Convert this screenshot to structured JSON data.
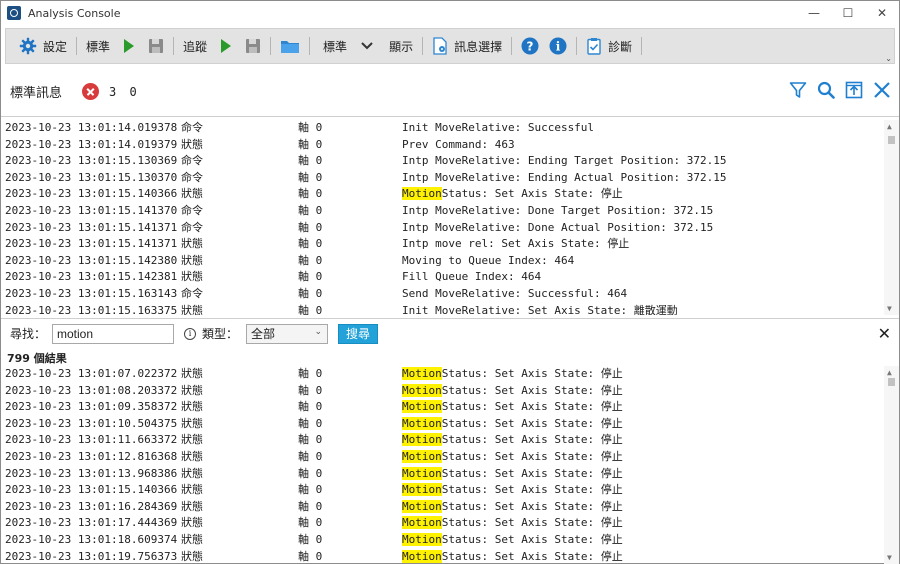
{
  "window": {
    "title": "Analysis Console",
    "minimize": "—",
    "maximize": "☐",
    "close": "✕"
  },
  "toolbar": {
    "settings": "設定",
    "standard1": "標準",
    "trace": "追蹤",
    "standard2": "標準",
    "display": "顯示",
    "message_select": "訊息選擇",
    "diagnose": "診斷",
    "overflow": "⌄"
  },
  "header": {
    "title": "標準訊息",
    "error_count": "3 0"
  },
  "log": [
    {
      "time": "2023-10-23 13:01:14.019378",
      "kind": "命令",
      "axis": "軸 0",
      "pre": "",
      "hl": "",
      "msg": "Init MoveRelative: Successful"
    },
    {
      "time": "2023-10-23 13:01:14.019379",
      "kind": "狀態",
      "axis": "軸 0",
      "pre": "",
      "hl": "",
      "msg": "Prev Command: 463"
    },
    {
      "time": "2023-10-23 13:01:15.130369",
      "kind": "命令",
      "axis": "軸 0",
      "pre": "",
      "hl": "",
      "msg": "Intp MoveRelative: Ending Target Position: 372.15"
    },
    {
      "time": "2023-10-23 13:01:15.130370",
      "kind": "命令",
      "axis": "軸 0",
      "pre": "",
      "hl": "",
      "msg": "Intp MoveRelative: Ending Actual Position: 372.15"
    },
    {
      "time": "2023-10-23 13:01:15.140366",
      "kind": "狀態",
      "axis": "軸 0",
      "pre": "",
      "hl": "Motion",
      "msg": "Status: Set Axis State: 停止"
    },
    {
      "time": "2023-10-23 13:01:15.141370",
      "kind": "命令",
      "axis": "軸 0",
      "pre": "",
      "hl": "",
      "msg": "Intp MoveRelative: Done Target Position: 372.15"
    },
    {
      "time": "2023-10-23 13:01:15.141371",
      "kind": "命令",
      "axis": "軸 0",
      "pre": "",
      "hl": "",
      "msg": "Intp MoveRelative: Done Actual Position: 372.15"
    },
    {
      "time": "2023-10-23 13:01:15.141371",
      "kind": "狀態",
      "axis": "軸 0",
      "pre": "",
      "hl": "",
      "msg": "Intp move rel: Set Axis State: 停止"
    },
    {
      "time": "2023-10-23 13:01:15.142380",
      "kind": "狀態",
      "axis": "軸 0",
      "pre": "",
      "hl": "",
      "msg": "Moving to Queue Index: 464"
    },
    {
      "time": "2023-10-23 13:01:15.142381",
      "kind": "狀態",
      "axis": "軸 0",
      "pre": "",
      "hl": "",
      "msg": "Fill Queue Index: 464"
    },
    {
      "time": "2023-10-23 13:01:15.163143",
      "kind": "命令",
      "axis": "軸 0",
      "pre": "",
      "hl": "",
      "msg": "Send MoveRelative: Successful: 464"
    },
    {
      "time": "2023-10-23 13:01:15.163375",
      "kind": "狀態",
      "axis": "軸 0",
      "pre": "",
      "hl": "",
      "msg": "Init MoveRelative: Set Axis State: 離散運動"
    }
  ],
  "search": {
    "label": "尋找：",
    "value": "motion",
    "type_label": "類型：",
    "type_value": "全部",
    "button": "搜尋",
    "close": "✕",
    "result_count": "799 個結果"
  },
  "results": [
    {
      "time": "2023-10-23 13:01:07.022372",
      "kind": "狀態",
      "axis": "軸 0",
      "hl": "Motion",
      "msg": "Status: Set Axis State: 停止"
    },
    {
      "time": "2023-10-23 13:01:08.203372",
      "kind": "狀態",
      "axis": "軸 0",
      "hl": "Motion",
      "msg": "Status: Set Axis State: 停止"
    },
    {
      "time": "2023-10-23 13:01:09.358372",
      "kind": "狀態",
      "axis": "軸 0",
      "hl": "Motion",
      "msg": "Status: Set Axis State: 停止"
    },
    {
      "time": "2023-10-23 13:01:10.504375",
      "kind": "狀態",
      "axis": "軸 0",
      "hl": "Motion",
      "msg": "Status: Set Axis State: 停止"
    },
    {
      "time": "2023-10-23 13:01:11.663372",
      "kind": "狀態",
      "axis": "軸 0",
      "hl": "Motion",
      "msg": "Status: Set Axis State: 停止"
    },
    {
      "time": "2023-10-23 13:01:12.816368",
      "kind": "狀態",
      "axis": "軸 0",
      "hl": "Motion",
      "msg": "Status: Set Axis State: 停止"
    },
    {
      "time": "2023-10-23 13:01:13.968386",
      "kind": "狀態",
      "axis": "軸 0",
      "hl": "Motion",
      "msg": "Status: Set Axis State: 停止"
    },
    {
      "time": "2023-10-23 13:01:15.140366",
      "kind": "狀態",
      "axis": "軸 0",
      "hl": "Motion",
      "msg": "Status: Set Axis State: 停止"
    },
    {
      "time": "2023-10-23 13:01:16.284369",
      "kind": "狀態",
      "axis": "軸 0",
      "hl": "Motion",
      "msg": "Status: Set Axis State: 停止"
    },
    {
      "time": "2023-10-23 13:01:17.444369",
      "kind": "狀態",
      "axis": "軸 0",
      "hl": "Motion",
      "msg": "Status: Set Axis State: 停止"
    },
    {
      "time": "2023-10-23 13:01:18.609374",
      "kind": "狀態",
      "axis": "軸 0",
      "hl": "Motion",
      "msg": "Status: Set Axis State: 停止"
    },
    {
      "time": "2023-10-23 13:01:19.756373",
      "kind": "狀態",
      "axis": "軸 0",
      "hl": "Motion",
      "msg": "Status: Set Axis State: 停止"
    }
  ],
  "colors": {
    "accent": "#22a2d8",
    "play": "#2a9b2a",
    "error": "#d83b3b",
    "highlight": "#fff200"
  }
}
